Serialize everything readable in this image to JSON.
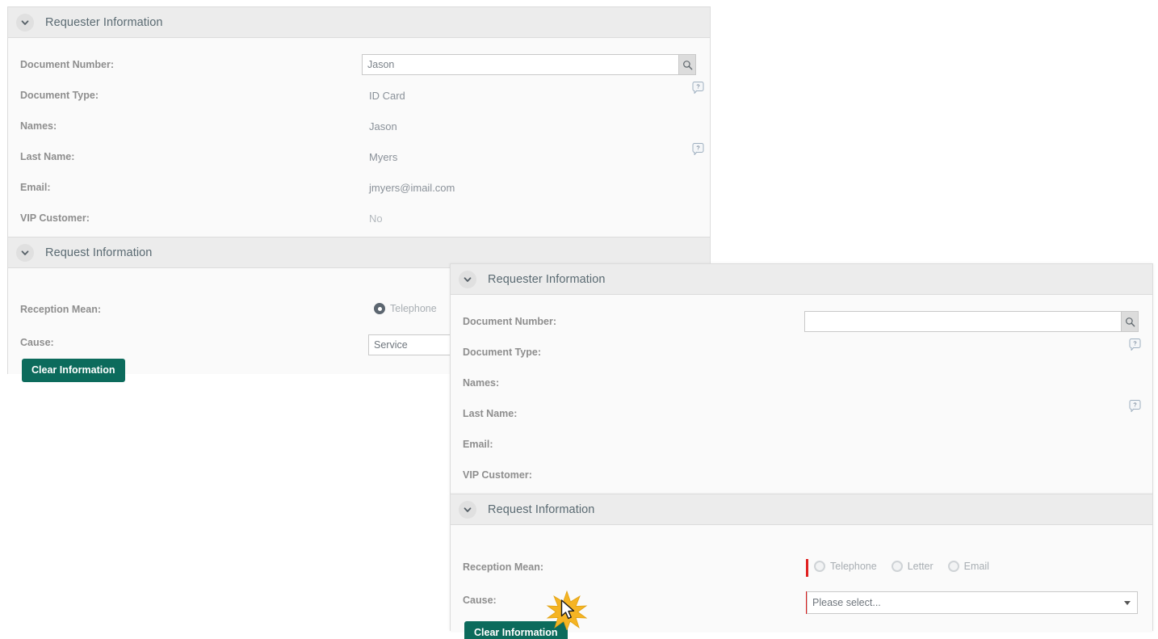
{
  "background_panel": {
    "requester_section": {
      "title": "Requester Information",
      "fields": [
        {
          "label": "Document Number:",
          "value": "Jason",
          "type": "search"
        },
        {
          "label": "Document Type:",
          "value": "ID Card",
          "help": true
        },
        {
          "label": "Names:",
          "value": "Jason"
        },
        {
          "label": "Last Name:",
          "value": "Myers",
          "help": true
        },
        {
          "label": "Email:",
          "value": "jmyers@imail.com"
        },
        {
          "label": "VIP Customer:",
          "value": "No",
          "muted": true
        }
      ]
    },
    "request_section": {
      "title": "Request Information",
      "reception_mean_label": "Reception Mean:",
      "reception_options": [
        {
          "label": "Telephone",
          "checked": true
        }
      ],
      "cause_label": "Cause:",
      "cause_value": "Service",
      "clear_button_label": "Clear Information"
    }
  },
  "overlay_panel": {
    "requester_section": {
      "title": "Requester Information",
      "fields": [
        {
          "label": "Document Number:",
          "value": "",
          "type": "search",
          "placeholder": ""
        },
        {
          "label": "Document Type:",
          "value": "",
          "help": true
        },
        {
          "label": "Names:",
          "value": ""
        },
        {
          "label": "Last Name:",
          "value": "",
          "help": true
        },
        {
          "label": "Email:",
          "value": ""
        },
        {
          "label": "VIP Customer:",
          "value": ""
        }
      ]
    },
    "request_section": {
      "title": "Request Information",
      "reception_mean_label": "Reception Mean:",
      "reception_options": [
        {
          "label": "Telephone",
          "checked": false
        },
        {
          "label": "Letter",
          "checked": false
        },
        {
          "label": "Email",
          "checked": false
        }
      ],
      "cause_label": "Cause:",
      "cause_value": "Please select...",
      "clear_button_label": "Clear Information"
    }
  },
  "colors": {
    "accent_green": "#0c6b5c",
    "required_red": "#e02020",
    "panel_header": "#ececec",
    "panel_body": "#fafafa",
    "label_gray": "#8e8e8e",
    "value_gray": "#8a9199",
    "click_marker": "#f5b423"
  },
  "icons": {
    "chevron": "chevron-down-icon",
    "search": "search-icon",
    "help": "help-bubble-icon",
    "cursor": "mouse-cursor-icon"
  }
}
